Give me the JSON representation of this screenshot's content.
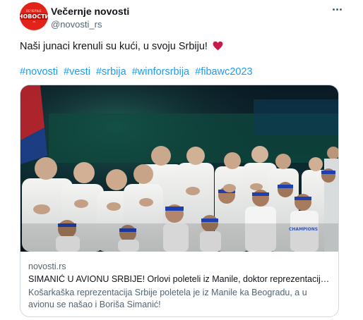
{
  "tweet": {
    "author": {
      "name": "Večernje novosti",
      "handle": "@novosti_rs",
      "avatar_logo": "НОВОСТИ"
    },
    "text": "Naši junaci krenuli su kući, u svoju Srbiju!",
    "hashtags": [
      "#novosti",
      "#vesti",
      "#srbija",
      "#winforsrbija",
      "#fibawc2023"
    ],
    "more_icon": "more-horizontal-icon",
    "heart_icon": "red-heart-icon"
  },
  "card": {
    "domain": "novosti.rs",
    "title": "SIMANIĆ U AVIONU SRBIJE! Orlovi poleteli iz Manile, doktor reprezentacije ot...",
    "description": "Košarkaška reprezentacija Srbije poletela je iz Manile ka Beogradu, a u avionu se našao i Boriša Simanić!",
    "image_alt": "Serbian basketball team lined up with hands on hearts",
    "shirt_texts": {
      "mascot": "CHAMPIONS"
    }
  },
  "colors": {
    "accent": "#1d9bf0",
    "heart": "#c9184a",
    "brand": "#e2231a"
  }
}
